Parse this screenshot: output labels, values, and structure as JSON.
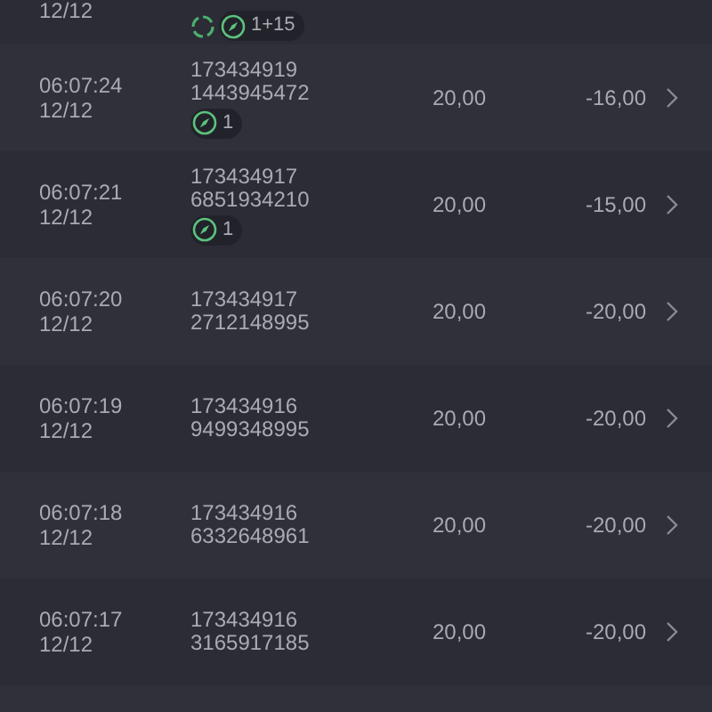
{
  "rows": [
    {
      "date": "12/12",
      "badges": [
        {
          "kind": "sync"
        },
        {
          "kind": "compass",
          "count": "1+15"
        }
      ]
    },
    {
      "time": "06:07:24",
      "date": "12/12",
      "ids": [
        "173434919",
        "1443945472"
      ],
      "badges": [
        {
          "kind": "compass",
          "count": "1"
        }
      ],
      "amount": "20,00",
      "change": "-16,00"
    },
    {
      "time": "06:07:21",
      "date": "12/12",
      "ids": [
        "173434917",
        "6851934210"
      ],
      "badges": [
        {
          "kind": "compass",
          "count": "1"
        }
      ],
      "amount": "20,00",
      "change": "-15,00"
    },
    {
      "time": "06:07:20",
      "date": "12/12",
      "ids": [
        "173434917",
        "2712148995"
      ],
      "amount": "20,00",
      "change": "-20,00"
    },
    {
      "time": "06:07:19",
      "date": "12/12",
      "ids": [
        "173434916",
        "9499348995"
      ],
      "amount": "20,00",
      "change": "-20,00"
    },
    {
      "time": "06:07:18",
      "date": "12/12",
      "ids": [
        "173434916",
        "6332648961"
      ],
      "amount": "20,00",
      "change": "-20,00"
    },
    {
      "time": "06:07:17",
      "date": "12/12",
      "ids": [
        "173434916",
        "3165917185"
      ],
      "amount": "20,00",
      "change": "-20,00"
    }
  ]
}
